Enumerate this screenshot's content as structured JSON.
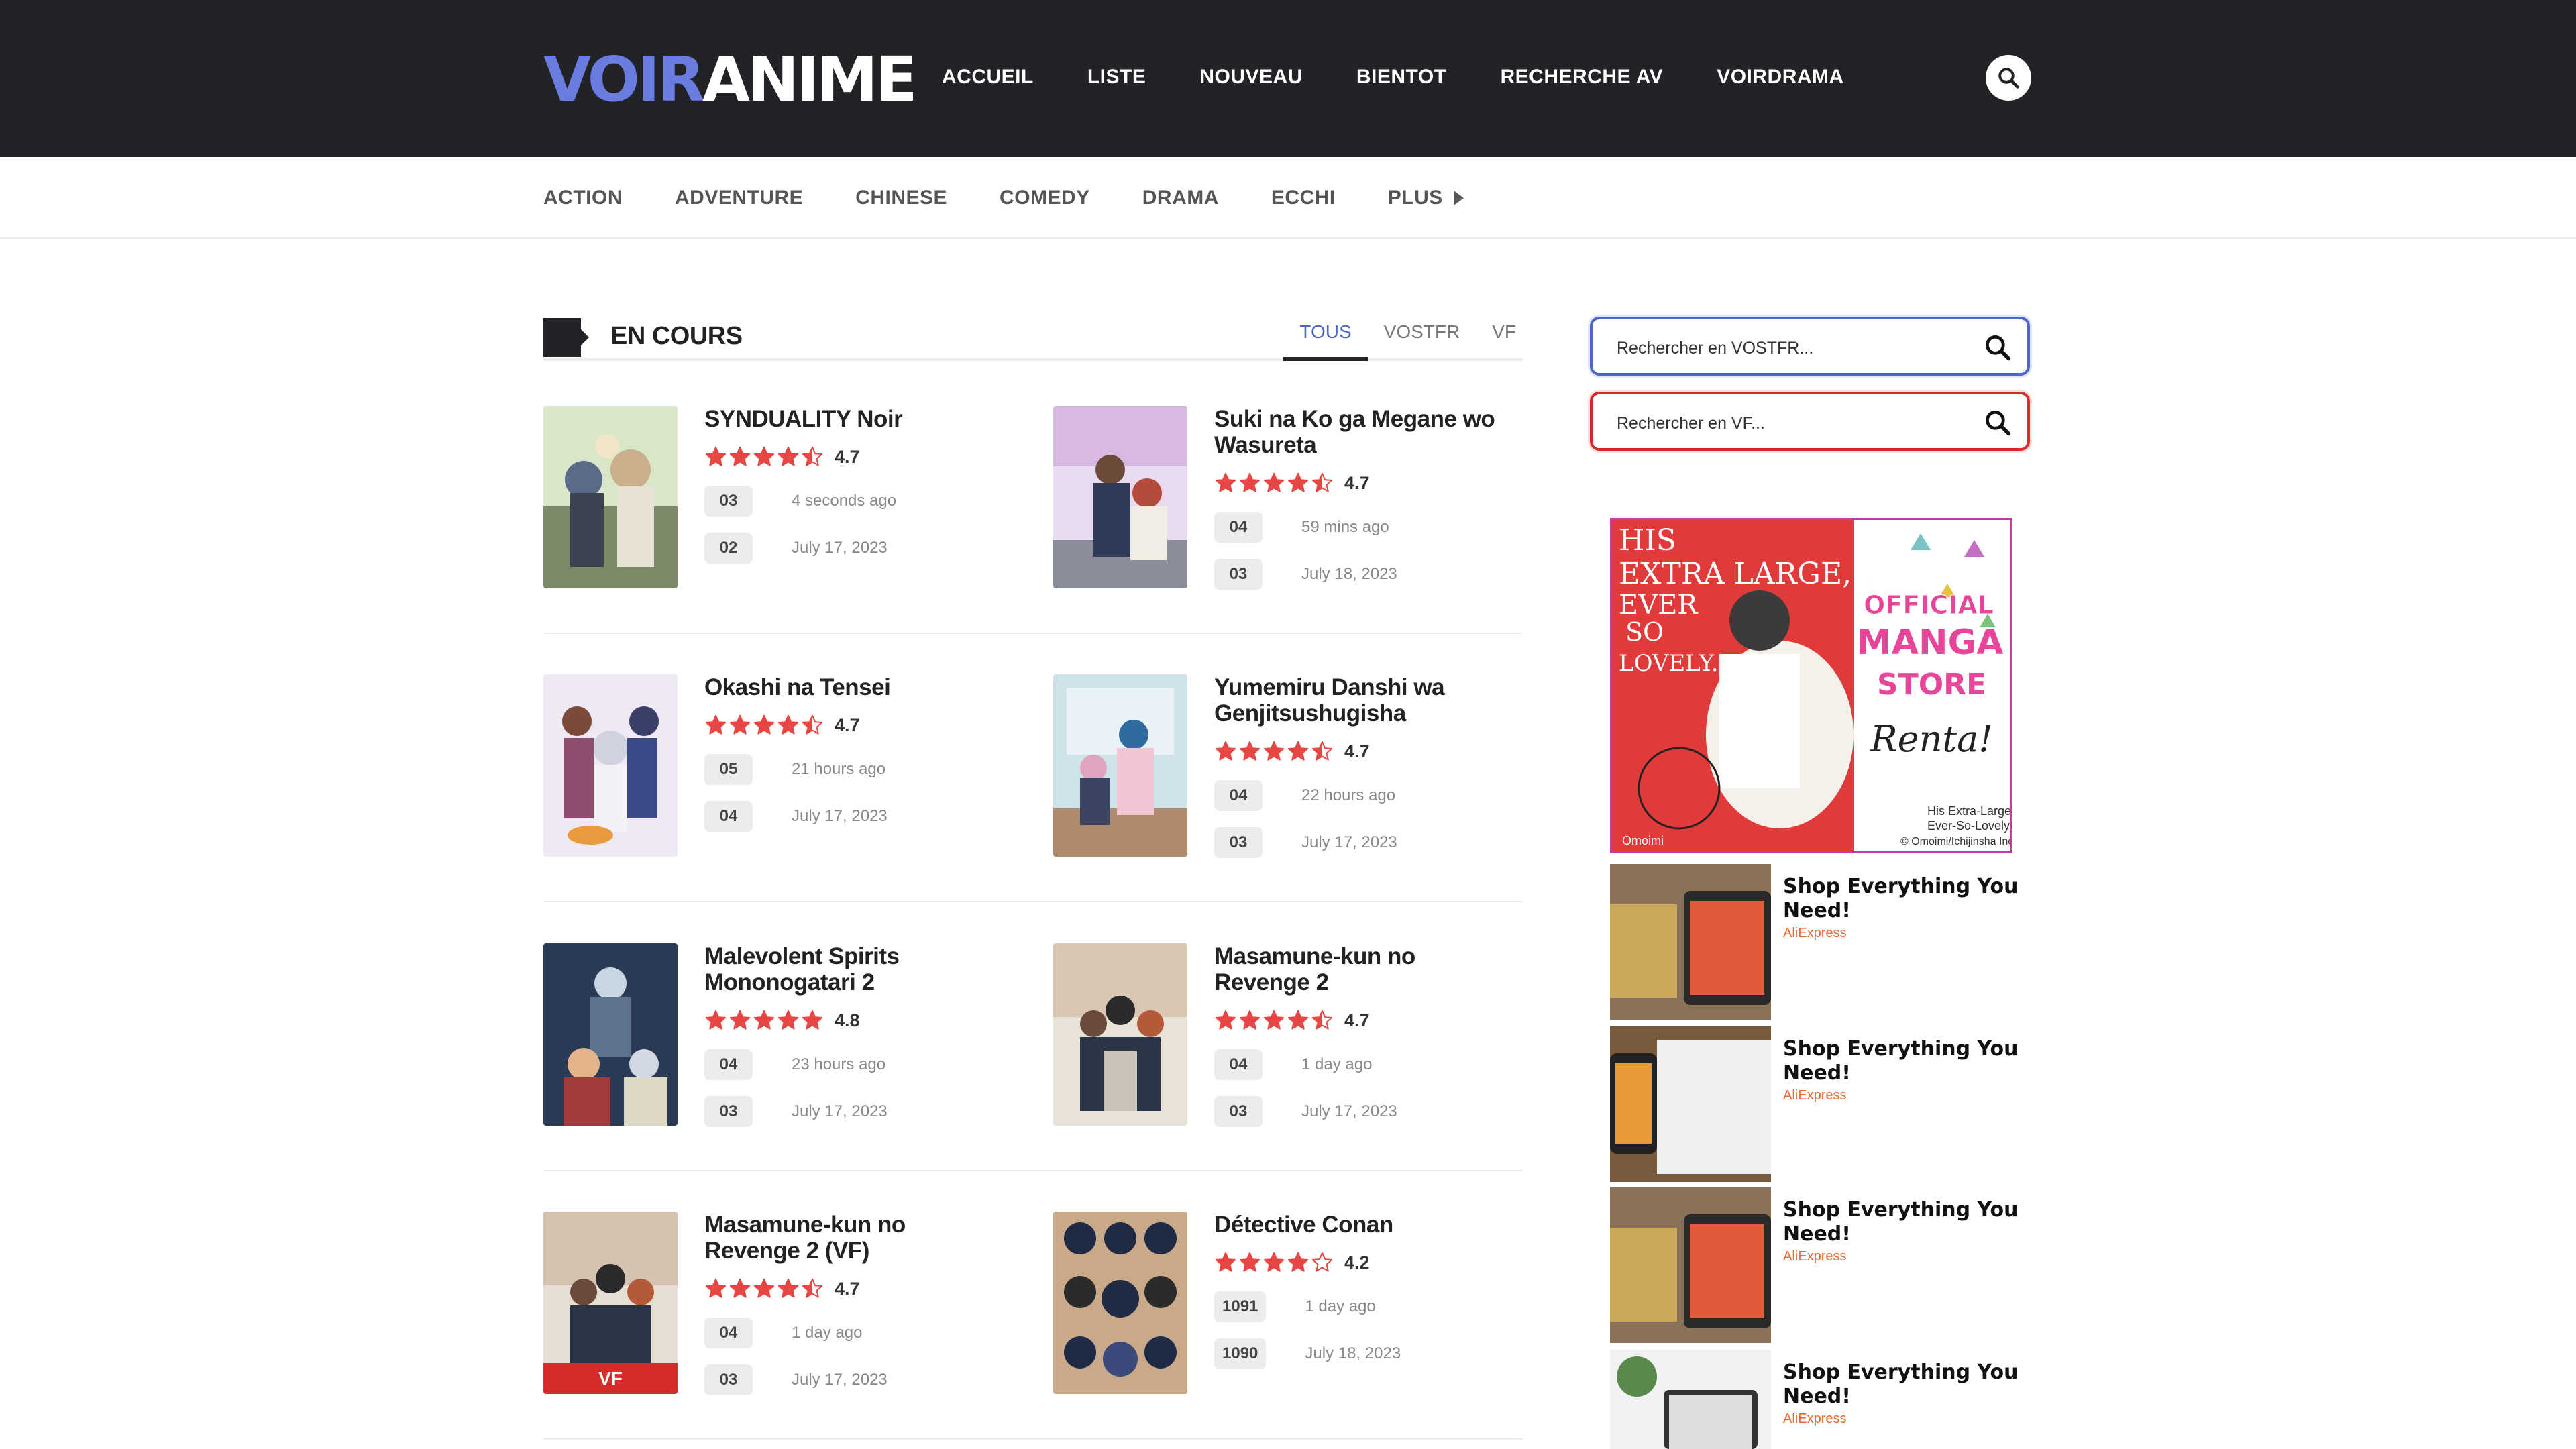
{
  "header": {
    "logo_part1": "VOIR",
    "logo_part2": "ANIME",
    "nav": [
      "ACCUEIL",
      "LISTE",
      "NOUVEAU",
      "BIENTOT",
      "RECHERCHE AV",
      "VOIRDRAMA"
    ]
  },
  "genres": [
    "ACTION",
    "ADVENTURE",
    "CHINESE",
    "COMEDY",
    "DRAMA",
    "ECCHI"
  ],
  "genres_more": "PLUS",
  "section": {
    "title": "EN COURS",
    "tabs": [
      "TOUS",
      "VOSTFR",
      "VF"
    ],
    "active_tab": "TOUS"
  },
  "cards": [
    {
      "title": "SYNDUALITY Noir",
      "rating": 4.7,
      "rating_text": "4.7",
      "ep1": "03",
      "time1": "4 seconds ago",
      "ep2": "02",
      "time2": "July 17, 2023"
    },
    {
      "title": "Suki na Ko ga Megane wo Wasureta",
      "rating": 4.7,
      "rating_text": "4.7",
      "ep1": "04",
      "time1": "59 mins ago",
      "ep2": "03",
      "time2": "July 18, 2023"
    },
    {
      "title": "Okashi na Tensei",
      "rating": 4.7,
      "rating_text": "4.7",
      "ep1": "05",
      "time1": "21 hours ago",
      "ep2": "04",
      "time2": "July 17, 2023"
    },
    {
      "title": "Yumemiru Danshi wa Genjitsushugisha",
      "rating": 4.7,
      "rating_text": "4.7",
      "ep1": "04",
      "time1": "22 hours ago",
      "ep2": "03",
      "time2": "July 17, 2023"
    },
    {
      "title": "Malevolent Spirits Mononogatari 2",
      "rating": 4.8,
      "rating_text": "4.8",
      "ep1": "04",
      "time1": "23 hours ago",
      "ep2": "03",
      "time2": "July 17, 2023"
    },
    {
      "title": "Masamune-kun no Revenge 2",
      "rating": 4.7,
      "rating_text": "4.7",
      "ep1": "04",
      "time1": "1 day ago",
      "ep2": "03",
      "time2": "July 17, 2023"
    },
    {
      "title": "Masamune-kun no Revenge 2 (VF)",
      "rating": 4.7,
      "rating_text": "4.7",
      "ep1": "04",
      "time1": "1 day ago",
      "ep2": "03",
      "time2": "July 17, 2023",
      "tag": "VF"
    },
    {
      "title": "Détective Conan",
      "rating": 4.2,
      "rating_text": "4.2",
      "ep1": "1091",
      "time1": "1 day ago",
      "ep2": "1090",
      "time2": "July 18, 2023"
    }
  ],
  "sidebar": {
    "search_vostfr_placeholder": "Rechercher en VOSTFR...",
    "search_vf_placeholder": "Rechercher en VF...",
    "ad_lines": [
      "HIS",
      "EXTRA LARGE,",
      "EVER",
      "SO",
      "LOVELY...",
      "OFFICIAL",
      "MANGA",
      "STORE",
      "Renta!",
      "His Extra-Large,",
      "Ever-So-Lovely...",
      "© Omoimi/Ichijinsha Inc.",
      "Omoimi"
    ],
    "ads": [
      {
        "title": "Shop Everything You Need!",
        "source": "AliExpress"
      },
      {
        "title": "Shop Everything You Need!",
        "source": "AliExpress"
      },
      {
        "title": "Shop Everything You Need!",
        "source": "AliExpress"
      },
      {
        "title": "Shop Everything You Need!",
        "source": "AliExpress"
      }
    ]
  },
  "colors": {
    "header_bg": "#222327",
    "accent_blue": "#6a7ce0",
    "star_red": "#e84545",
    "vf_red": "#d62b2b"
  }
}
